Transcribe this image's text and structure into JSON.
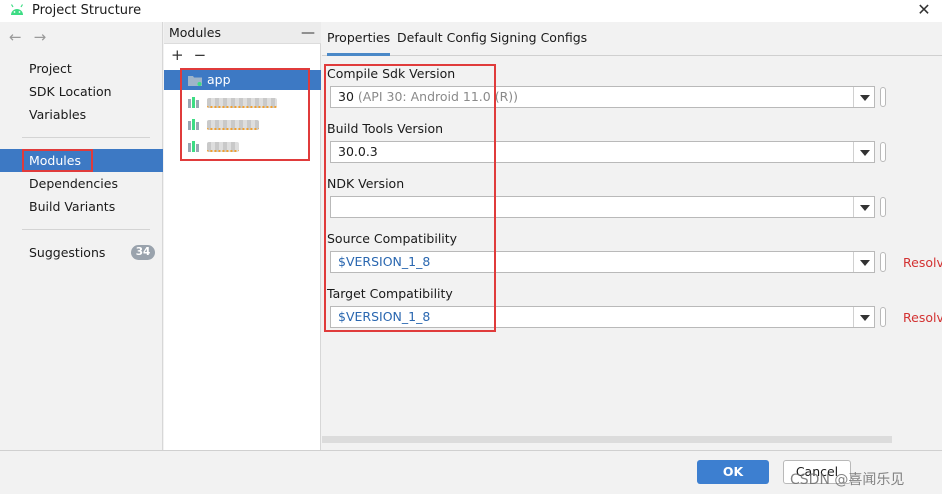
{
  "window": {
    "title": "Project Structure"
  },
  "nav": {
    "items": [
      {
        "label": "Project"
      },
      {
        "label": "SDK Location"
      },
      {
        "label": "Variables"
      },
      {
        "label": "Modules"
      },
      {
        "label": "Dependencies"
      },
      {
        "label": "Build Variants"
      },
      {
        "label": "Suggestions",
        "badge": "34"
      }
    ],
    "selected": "Modules"
  },
  "modules": {
    "header": "Modules",
    "add": "+",
    "remove": "−",
    "collapse": "—",
    "items": [
      {
        "label": "app"
      }
    ]
  },
  "tabs": [
    {
      "label": "Properties"
    },
    {
      "label": "Default Config"
    },
    {
      "label": "Signing Configs"
    }
  ],
  "properties": {
    "compile_sdk": {
      "label": "Compile Sdk Version",
      "value": "30",
      "hint": " (API 30: Android 11.0 (R))"
    },
    "build_tools": {
      "label": "Build Tools Version",
      "value": "30.0.3"
    },
    "ndk": {
      "label": "NDK Version",
      "value": ""
    },
    "source_compat": {
      "label": "Source Compatibility",
      "value": "$VERSION_1_8",
      "action": "Resolve"
    },
    "target_compat": {
      "label": "Target Compatibility",
      "value": "$VERSION_1_8",
      "action": "Resolve"
    }
  },
  "buttons": {
    "ok": "OK",
    "cancel": "Cancel"
  },
  "watermark": "CSDN @喜闻乐见",
  "colors": {
    "accent": "#3d79c4",
    "highlight_box": "#e03b3b",
    "link_blue": "#2a67b0",
    "resolve_red": "#d33232"
  }
}
